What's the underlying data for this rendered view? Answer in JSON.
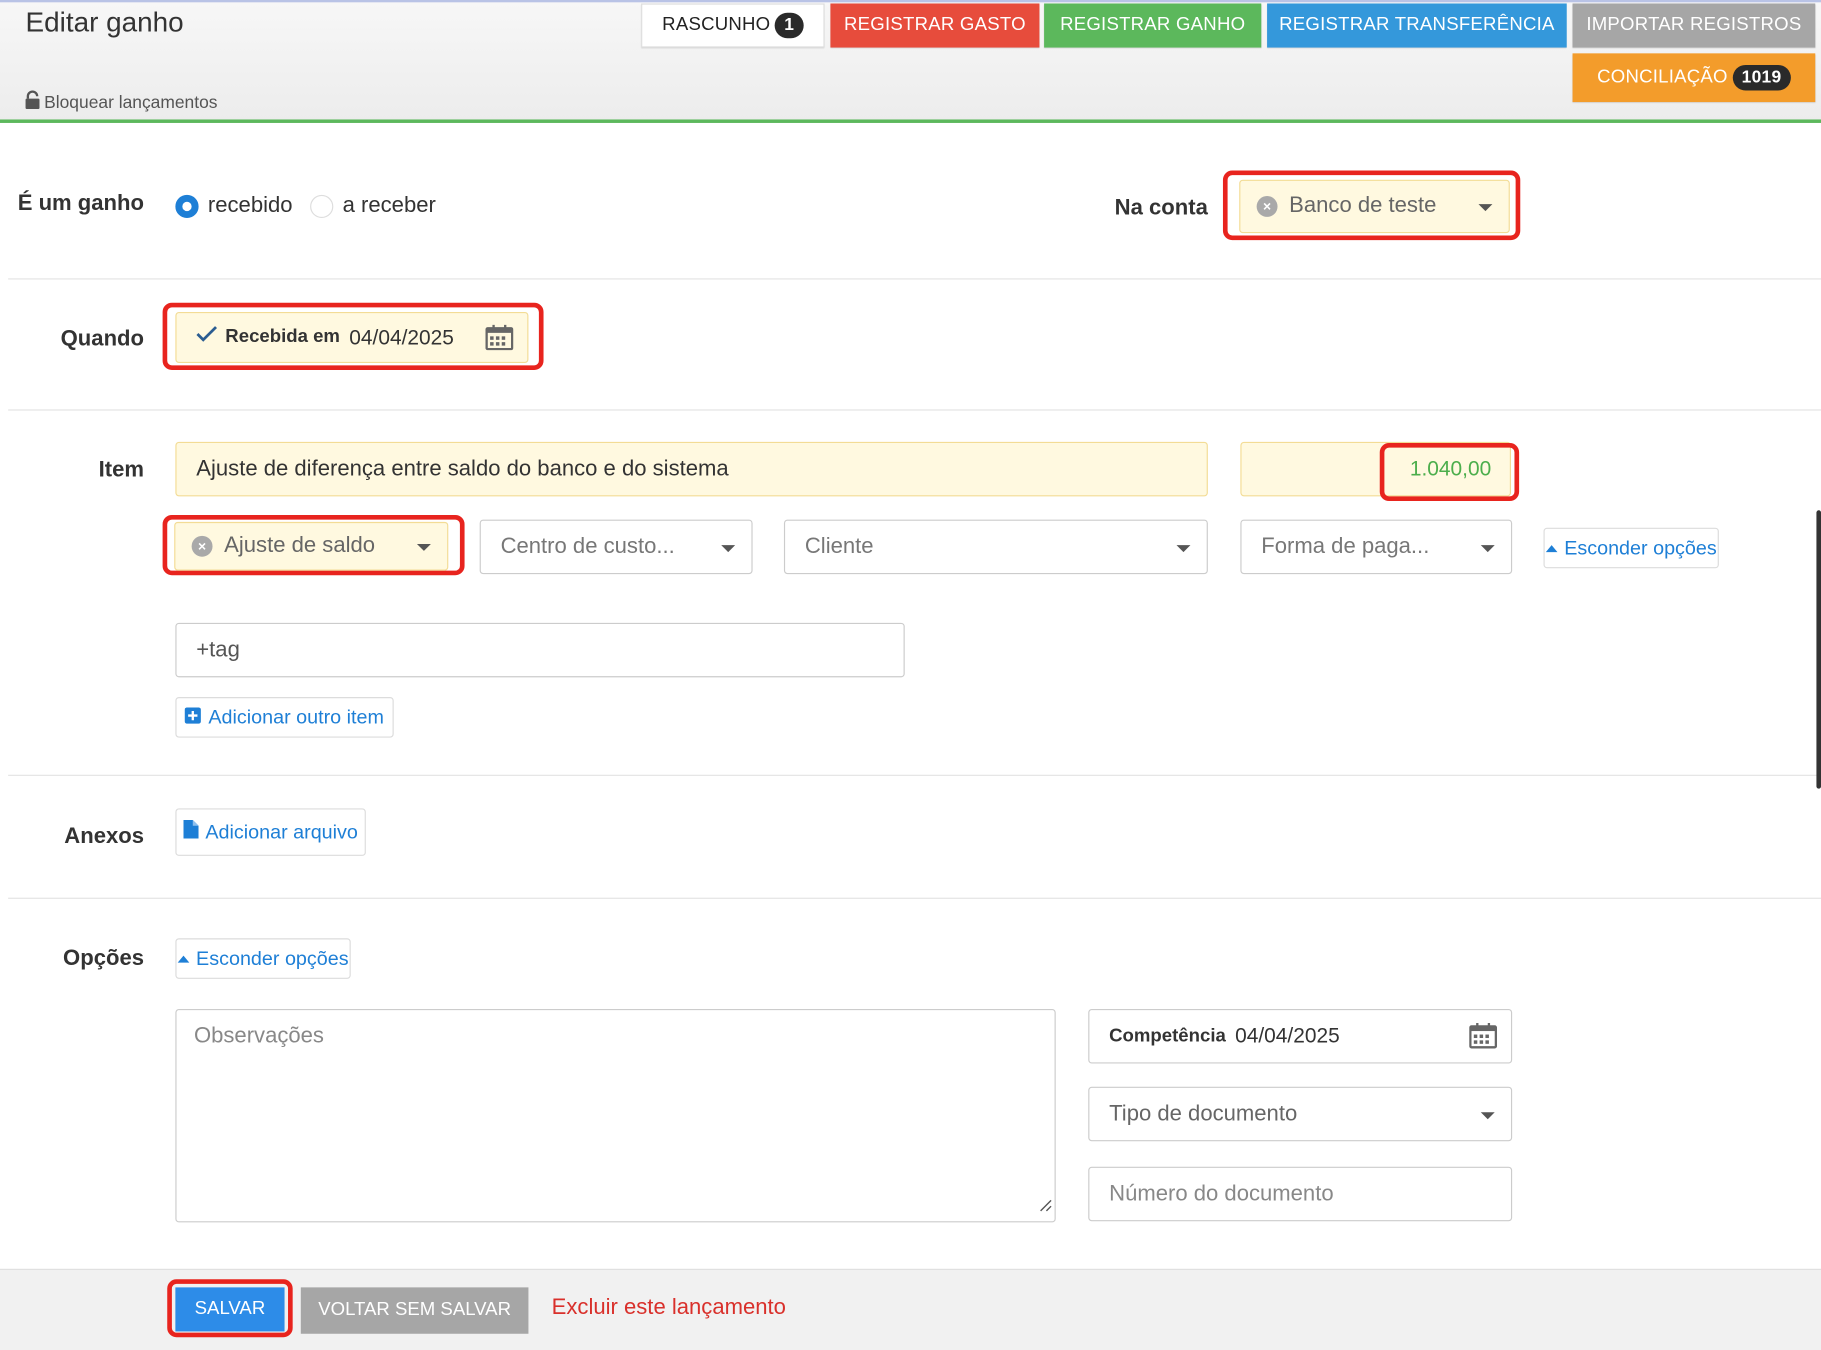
{
  "header": {
    "title": "Editar ganho",
    "lock_label": "Bloquear lançamentos",
    "buttons": {
      "rascunho": "RASCUNHO",
      "rascunho_count": "1",
      "registrar_gasto": "REGISTRAR GASTO",
      "registrar_ganho": "REGISTRAR GANHO",
      "registrar_transferencia": "REGISTRAR TRANSFERÊNCIA",
      "importar_registros": "IMPORTAR REGISTROS",
      "conciliacao": "CONCILIAÇÃO",
      "conciliacao_count": "1019"
    }
  },
  "form": {
    "type_label": "É um ganho",
    "status_options": [
      "recebido",
      "a receber"
    ],
    "status_selected": "recebido",
    "account_label": "Na conta",
    "account_value": "Banco de teste",
    "when_label": "Quando",
    "when_prefix": "Recebida em",
    "when_date": "04/04/2025",
    "item_label": "Item",
    "item_description": "Ajuste de diferença entre saldo do banco e do sistema",
    "item_amount": "1.040,00",
    "category_value": "Ajuste de saldo",
    "cost_center_placeholder": "Centro de custo...",
    "client_placeholder": "Cliente",
    "payment_placeholder": "Forma de paga...",
    "hide_options_label": "Esconder opções",
    "tag_placeholder": "+tag",
    "add_item_label": "Adicionar outro item",
    "attachments_label": "Anexos",
    "add_file_label": "Adicionar arquivo",
    "options_label": "Opções",
    "options_hide_label": "Esconder opções",
    "notes_placeholder": "Observações",
    "competence_prefix": "Competência",
    "competence_date": "04/04/2025",
    "doc_type_placeholder": "Tipo de documento",
    "doc_number_placeholder": "Número do documento"
  },
  "footer": {
    "save_label": "SALVAR",
    "back_label": "VOLTAR SEM SALVAR",
    "delete_label": "Excluir este lançamento"
  },
  "colors": {
    "gasto": "#e74c3c",
    "ganho": "#5cb85c",
    "transferencia": "#3498db",
    "importar": "#a6a6a6",
    "conciliacao": "#f39c2b",
    "highlight": "#e8241e",
    "amount_green": "#4cae4c",
    "link_blue": "#1e7fd6"
  }
}
